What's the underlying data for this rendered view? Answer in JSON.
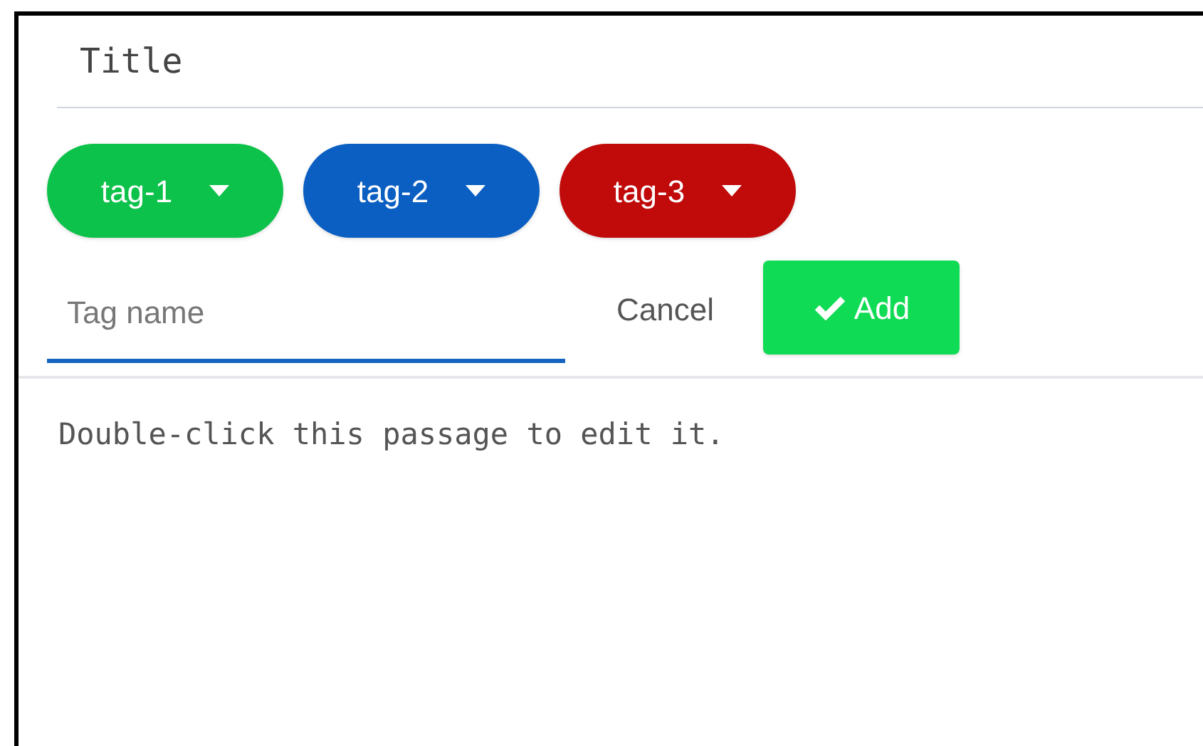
{
  "title": "Title",
  "tags": [
    {
      "label": "tag-1",
      "color": "#0cc24a"
    },
    {
      "label": "tag-2",
      "color": "#0b5fc2"
    },
    {
      "label": "tag-3",
      "color": "#c10a0a"
    }
  ],
  "tag_input": {
    "placeholder": "Tag name"
  },
  "cancel_button": "Cancel",
  "add_button": "Add",
  "passage": "Double-click this passage to edit it."
}
